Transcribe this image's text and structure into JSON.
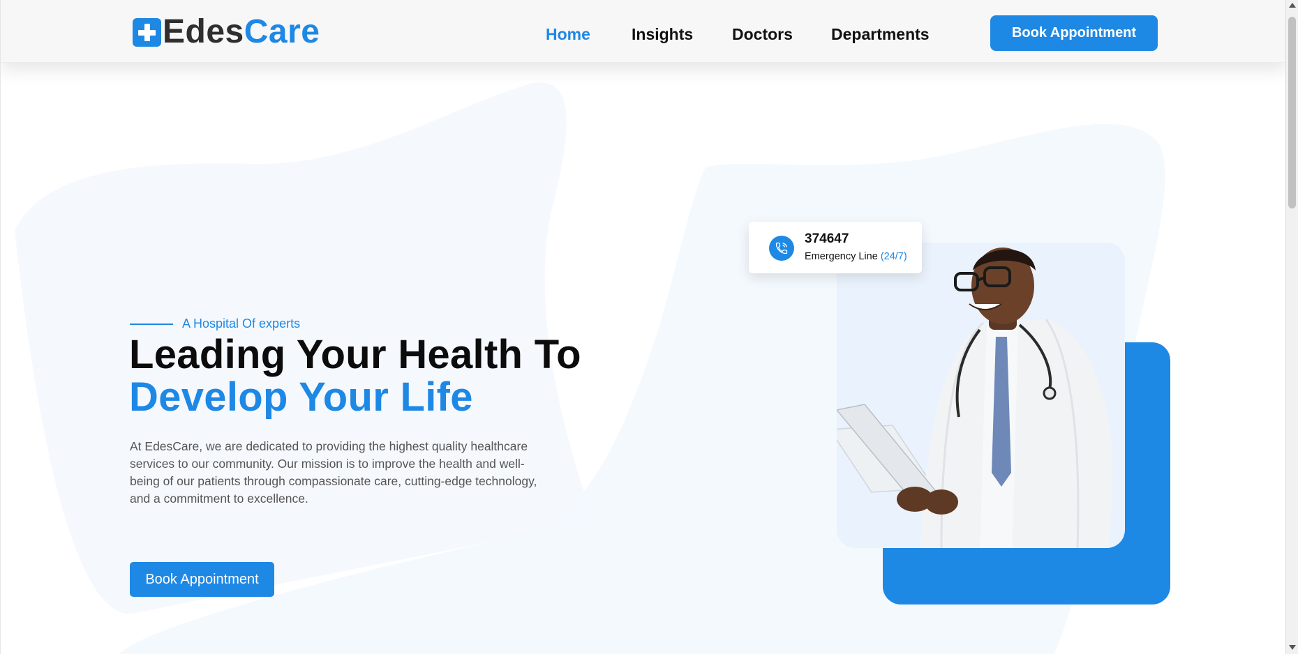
{
  "brand": {
    "part1": "Edes",
    "part2": "Care",
    "icon": "medical-cross-icon"
  },
  "nav": {
    "items": [
      {
        "label": "Home",
        "active": true
      },
      {
        "label": "Insights",
        "active": false
      },
      {
        "label": "Doctors",
        "active": false
      },
      {
        "label": "Departments",
        "active": false
      }
    ],
    "cta_label": "Book Appointment"
  },
  "hero": {
    "eyebrow": "A Hospital Of experts",
    "title_line1": "Leading Your Health To",
    "title_line2": "Develop Your Life",
    "description": "At EdesCare, we are dedicated to providing the highest quality healthcare services to our community. Our mission is to improve the health and well-being of our patients through compassionate care, cutting-edge technology, and a commitment to excellence.",
    "cta_label": "Book Appointment"
  },
  "emergency": {
    "number": "374647",
    "label": "Emergency Line",
    "hours": "(24/7)",
    "icon": "phone-icon"
  },
  "colors": {
    "accent": "#1e88e5",
    "text": "#111111",
    "muted": "#555555",
    "header_bg": "#f7f7f7"
  }
}
